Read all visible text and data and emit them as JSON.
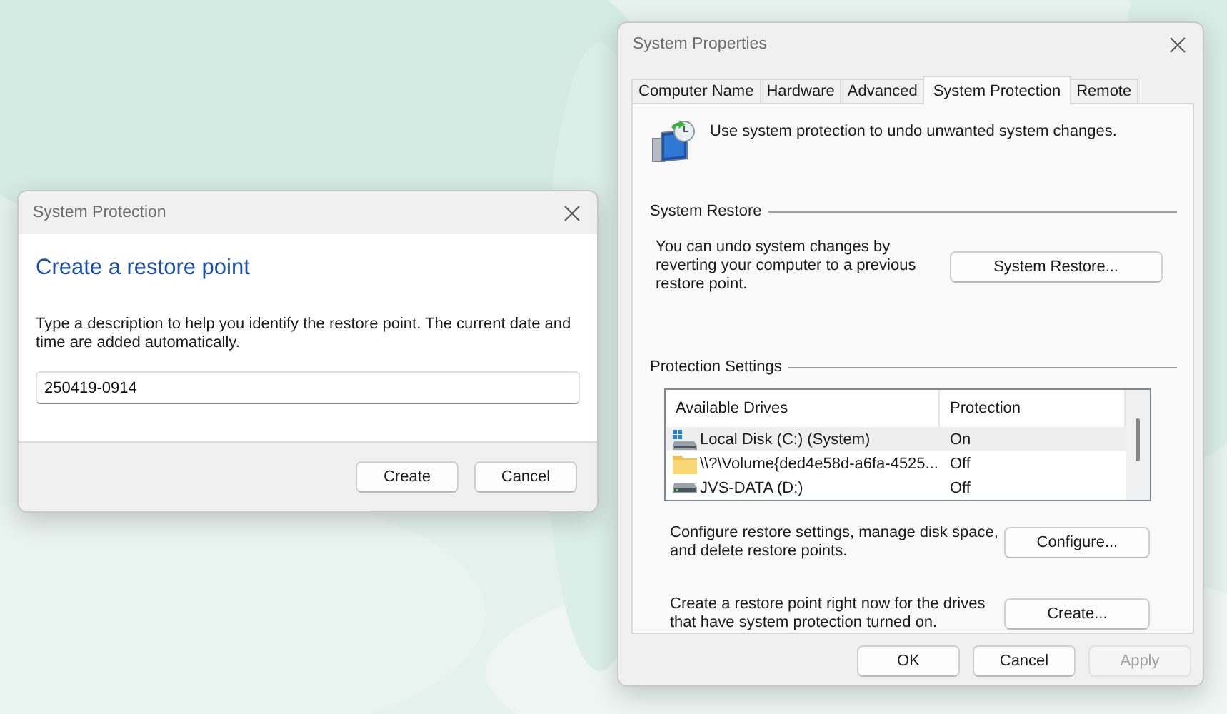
{
  "restore_dialog": {
    "title": "System Protection",
    "heading": "Create a restore point",
    "description": "Type a description to help you identify the restore point. The current date and time are added automatically.",
    "description_field": {
      "value": "250419-0914"
    },
    "buttons": [
      {
        "label": "Create"
      },
      {
        "label": "Cancel"
      }
    ]
  },
  "system_properties": {
    "title": "System Properties",
    "tabs": [
      {
        "label": "Computer Name",
        "selected": false
      },
      {
        "label": "Hardware",
        "selected": false
      },
      {
        "label": "Advanced",
        "selected": false
      },
      {
        "label": "System Protection",
        "selected": true
      },
      {
        "label": "Remote",
        "selected": false
      }
    ],
    "intro": "Use system protection to undo unwanted system changes.",
    "system_restore": {
      "heading": "System Restore",
      "text": "You can undo system changes by reverting your computer to a previous restore point.",
      "button": "System Restore..."
    },
    "protection_settings": {
      "heading": "Protection Settings",
      "columns": [
        "Available Drives",
        "Protection"
      ],
      "drives": [
        {
          "kind": "system",
          "name": "Local Disk (C:) (System)",
          "protection": "On",
          "selected": true
        },
        {
          "kind": "folder",
          "name": "\\\\?\\Volume{ded4e58d-a6fa-4525...",
          "protection": "Off",
          "selected": false
        },
        {
          "kind": "disk",
          "name": "JVS-DATA (D:)",
          "protection": "Off",
          "selected": false
        }
      ],
      "actions": [
        {
          "text": "Configure restore settings, manage disk space, and delete restore points.",
          "button": "Configure..."
        },
        {
          "text": "Create a restore point right now for the drives that have system protection turned on.",
          "button": "Create..."
        }
      ]
    },
    "buttons": [
      {
        "label": "OK",
        "disabled": false
      },
      {
        "label": "Cancel",
        "disabled": false
      },
      {
        "label": "Apply",
        "disabled": true
      }
    ]
  }
}
